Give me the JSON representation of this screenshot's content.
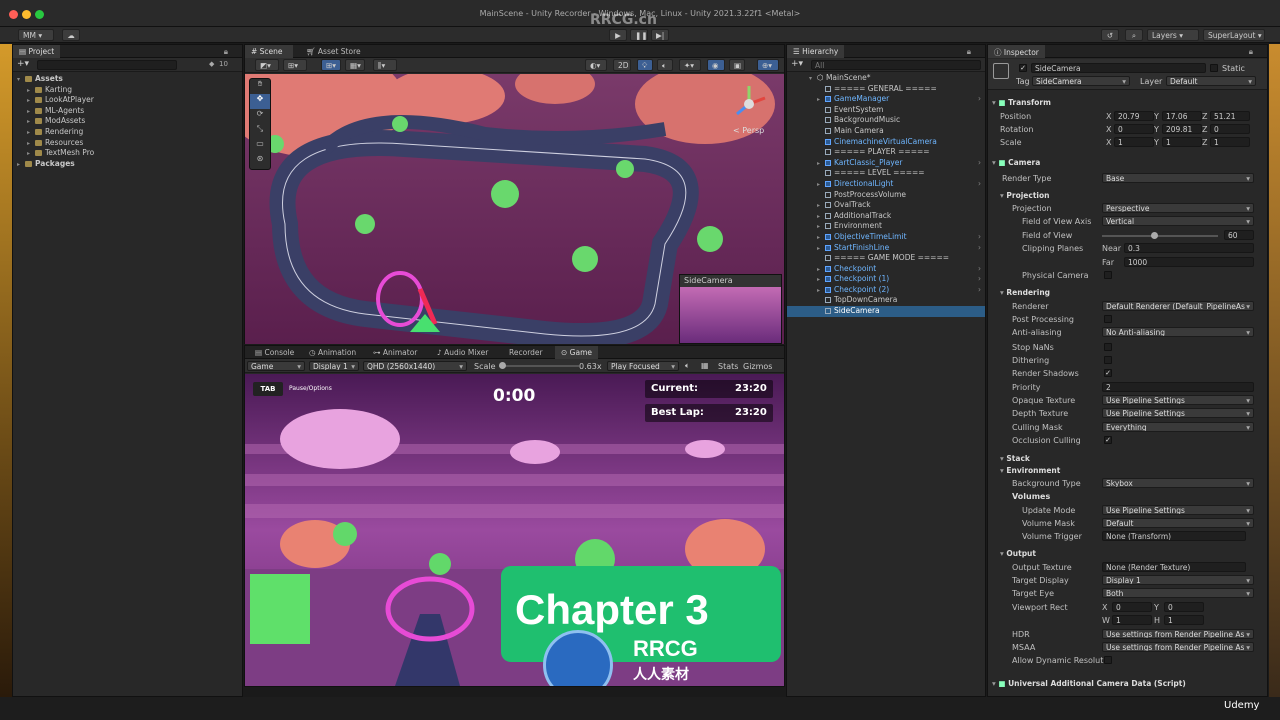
{
  "window": {
    "title": "MainScene - Unity Recorder - Windows, Mac, Linux - Unity 2021.3.22f1 <Metal>",
    "watermark_top": "RRCG.cn"
  },
  "toolbar": {
    "account": "MM",
    "layers": "Layers",
    "layout": "SuperLayout"
  },
  "project": {
    "tab": "Project",
    "count": "10",
    "assets_label": "Assets",
    "folders": [
      "Karting",
      "LookAtPlayer",
      "ML-Agents",
      "ModAssets",
      "Rendering",
      "Resources",
      "TextMesh Pro"
    ],
    "packages_label": "Packages"
  },
  "scene": {
    "tab_scene": "Scene",
    "tab_store": "Asset Store",
    "mode_2d": "2D",
    "persp": "< Persp",
    "side_camera_label": "SideCamera"
  },
  "game": {
    "tabs": [
      "Console",
      "Animation",
      "Animator",
      "Audio Mixer",
      "Recorder",
      "Game"
    ],
    "view": "Game",
    "display": "Display 1",
    "resolution": "QHD (2560x1440)",
    "scale_label": "Scale",
    "scale_value": "0.63x",
    "play_focused": "Play Focused",
    "stats": "Stats",
    "gizmos": "Gizmos",
    "hud": {
      "tab_key": "TAB",
      "tab_text": "Pause/Options",
      "timer": "0:00",
      "current_label": "Current:",
      "current_value": "23:20",
      "best_label": "Best Lap:",
      "best_value": "23:20"
    },
    "chapter": "Chapter 3",
    "logo_text": "RRCG",
    "logo_sub": "人人素材"
  },
  "hierarchy": {
    "tab": "Hierarchy",
    "search_placeholder": "All",
    "scene": "MainScene*",
    "items": [
      {
        "label": "===== GENERAL =====",
        "blue": false
      },
      {
        "label": "GameManager",
        "blue": true
      },
      {
        "label": "EventSystem",
        "blue": false
      },
      {
        "label": "BackgroundMusic",
        "blue": false
      },
      {
        "label": "Main Camera",
        "blue": false
      },
      {
        "label": "CinemachineVirtualCamera",
        "blue": true
      },
      {
        "label": "===== PLAYER =====",
        "blue": false
      },
      {
        "label": "KartClassic_Player",
        "blue": true
      },
      {
        "label": "===== LEVEL =====",
        "blue": false
      },
      {
        "label": "DirectionalLight",
        "blue": true
      },
      {
        "label": "PostProcessVolume",
        "blue": false
      },
      {
        "label": "OvalTrack",
        "blue": false
      },
      {
        "label": "AdditionalTrack",
        "blue": false
      },
      {
        "label": "Environment",
        "blue": false
      },
      {
        "label": "ObjectiveTimeLimit",
        "blue": true
      },
      {
        "label": "StartFinishLine",
        "blue": true
      },
      {
        "label": "===== GAME MODE =====",
        "blue": false
      },
      {
        "label": "Checkpoint",
        "blue": true
      },
      {
        "label": "Checkpoint (1)",
        "blue": true
      },
      {
        "label": "Checkpoint (2)",
        "blue": true
      },
      {
        "label": "TopDownCamera",
        "blue": false
      },
      {
        "label": "SideCamera",
        "blue": false
      }
    ]
  },
  "inspector": {
    "tab": "Inspector",
    "object_name": "SideCamera",
    "static": "Static",
    "tag_label": "Tag",
    "tag_value": "SideCamera",
    "layer_label": "Layer",
    "layer_value": "Default",
    "transform": {
      "title": "Transform",
      "position": {
        "label": "Position",
        "x": "20.79",
        "y": "17.06",
        "z": "51.21"
      },
      "rotation": {
        "label": "Rotation",
        "x": "0",
        "y": "209.81",
        "z": "0"
      },
      "scale": {
        "label": "Scale",
        "x": "1",
        "y": "1",
        "z": "1"
      }
    },
    "camera": {
      "title": "Camera",
      "render_type_label": "Render Type",
      "render_type": "Base",
      "projection_section": "Projection",
      "projection_label": "Projection",
      "projection": "Perspective",
      "fov_axis_label": "Field of View Axis",
      "fov_axis": "Vertical",
      "fov_label": "Field of View",
      "fov": "60",
      "fov_level": 0.45,
      "clipping_label": "Clipping Planes",
      "near_label": "Near",
      "near": "0.3",
      "far_label": "Far",
      "far": "1000",
      "physical_label": "Physical Camera",
      "rendering_section": "Rendering",
      "renderer_label": "Renderer",
      "renderer": "Default Renderer (Default_PipelineAs",
      "post_label": "Post Processing",
      "aa_label": "Anti-aliasing",
      "aa": "No Anti-aliasing",
      "nan_label": "Stop NaNs",
      "dither_label": "Dithering",
      "shadows_label": "Render Shadows",
      "priority_label": "Priority",
      "priority": "2",
      "opaque_label": "Opaque Texture",
      "opaque": "Use Pipeline Settings",
      "depth_label": "Depth Texture",
      "depth": "Use Pipeline Settings",
      "cull_label": "Culling Mask",
      "cull": "Everything",
      "occlusion_label": "Occlusion Culling",
      "stack_section": "Stack",
      "env_section": "Environment",
      "bg_label": "Background Type",
      "bg": "Skybox",
      "volumes_label": "Volumes",
      "update_label": "Update Mode",
      "update": "Use Pipeline Settings",
      "vmask_label": "Volume Mask",
      "vmask": "Default",
      "vtrigger_label": "Volume Trigger",
      "vtrigger": "None (Transform)",
      "output_section": "Output",
      "otex_label": "Output Texture",
      "otex": "None (Render Texture)",
      "tdisp_label": "Target Display",
      "tdisp": "Display 1",
      "teye_label": "Target Eye",
      "teye": "Both",
      "vrect_label": "Viewport Rect",
      "vx": "0",
      "vy": "0",
      "vw": "1",
      "vh": "1",
      "hdr_label": "HDR",
      "hdr": "Use settings from Render Pipeline As",
      "msaa_label": "MSAA",
      "msaa": "Use settings from Render Pipeline As",
      "dyn_label": "Allow Dynamic Resolutio"
    },
    "urp": "Universal Additional Camera Data (Script)"
  },
  "udemy": "Udemy"
}
